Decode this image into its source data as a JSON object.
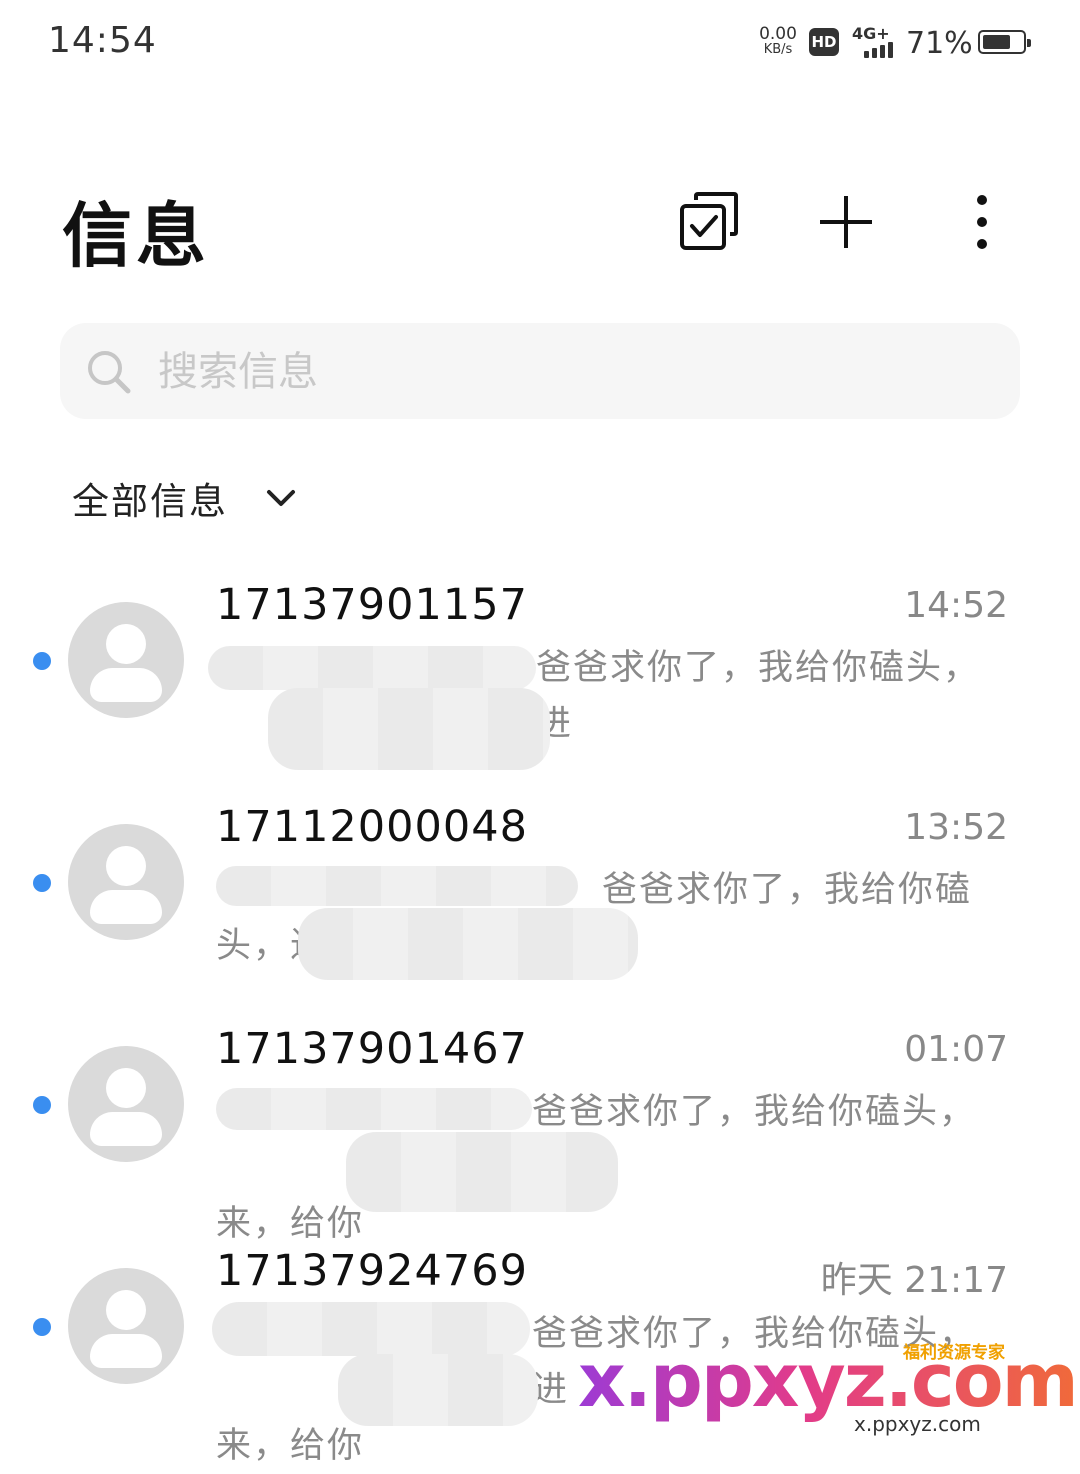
{
  "status_bar": {
    "time": "14:54",
    "net_speed_value": "0.00",
    "net_speed_unit": "KB/s",
    "hd_badge": "HD",
    "network_type": "4G+",
    "battery_percent": "71%",
    "battery_level": 0.71
  },
  "header": {
    "title": "信息",
    "batch_select_icon": "checkbox-square-icon",
    "new_message_icon": "plus-icon",
    "more_icon": "more-vertical-icon"
  },
  "search": {
    "placeholder": "搜索信息",
    "value": ""
  },
  "filter": {
    "label": "全部信息"
  },
  "conversations": [
    {
      "number": "17137901157",
      "time": "14:52",
      "unread": true,
      "preview_line1": "爸爸求你了，我给你磕头，进",
      "preview_line2": ""
    },
    {
      "number": "17112000048",
      "time": "13:52",
      "unread": true,
      "preview_line1": "爸爸求你了，我给你磕",
      "preview_line2": "头，进"
    },
    {
      "number": "17137901467",
      "time": "01:07",
      "unread": true,
      "preview_line1": "爸爸求你了，我给你磕头，进",
      "preview_line2": "来，给你"
    },
    {
      "number": "17137924769",
      "time": "昨天 21:17",
      "unread": true,
      "preview_line1": "爸爸求你了，我给你磕头，进",
      "preview_line2": "来，给你"
    }
  ],
  "colors": {
    "unread_dot": "#3a8ef0",
    "avatar_bg": "#dadada",
    "search_bg": "#f6f6f6"
  },
  "watermark": {
    "main": "x.ppxyz.com",
    "sub": "x.ppxyz.com",
    "tag": "福利资源专家"
  }
}
